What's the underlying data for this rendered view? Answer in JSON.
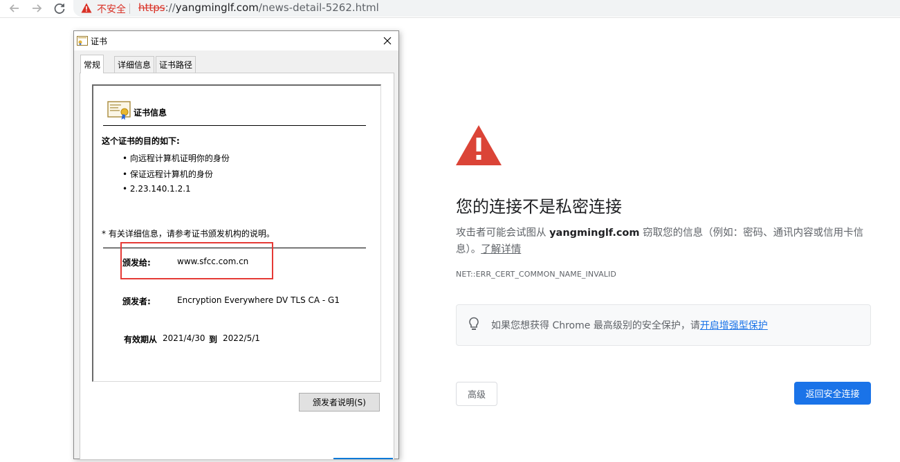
{
  "browser": {
    "insecure_label": "不安全",
    "url_scheme": "https",
    "url_sep": "://",
    "url_host": "yangminglf.com",
    "url_path": "/news-detail-5262.html"
  },
  "interstitial": {
    "heading": "您的连接不是私密连接",
    "explanation_pre": "攻击者可能会试图从 ",
    "explanation_host": "yangminglf.com",
    "explanation_post": " 窃取您的信息（例如：密码、通讯内容或信用卡信息）。",
    "learn_more": "了解详情",
    "error_code": "NET::ERR_CERT_COMMON_NAME_INVALID",
    "enhanced_text": "如果您想获得 Chrome 最高级别的安全保护，请",
    "enhanced_link": "开启增强型保护",
    "advanced_label": "高级",
    "back_label": "返回安全连接",
    "accent_color": "#1a73e8",
    "warning_color": "#db4437"
  },
  "dialog": {
    "title": "证书",
    "tabs": [
      "常规",
      "详细信息",
      "证书路径"
    ],
    "info_heading": "证书信息",
    "purpose_heading": "这个证书的目的如下:",
    "purposes": [
      "• 向远程计算机证明你的身份",
      "• 保证远程计算机的身份",
      "• 2.23.140.1.2.1"
    ],
    "note": "* 有关详细信息，请参考证书颁发机构的说明。",
    "issued_to_label": "颁发给:",
    "issued_to": "www.sfcc.com.cn",
    "issued_by_label": "颁发者:",
    "issued_by": "Encryption Everywhere DV TLS CA - G1",
    "valid_from_label": "有效期从",
    "valid_from": "2021/4/30",
    "valid_to_label": "到",
    "valid_to": "2022/5/1",
    "issuer_statement_button": "颁发者说明(S)"
  }
}
